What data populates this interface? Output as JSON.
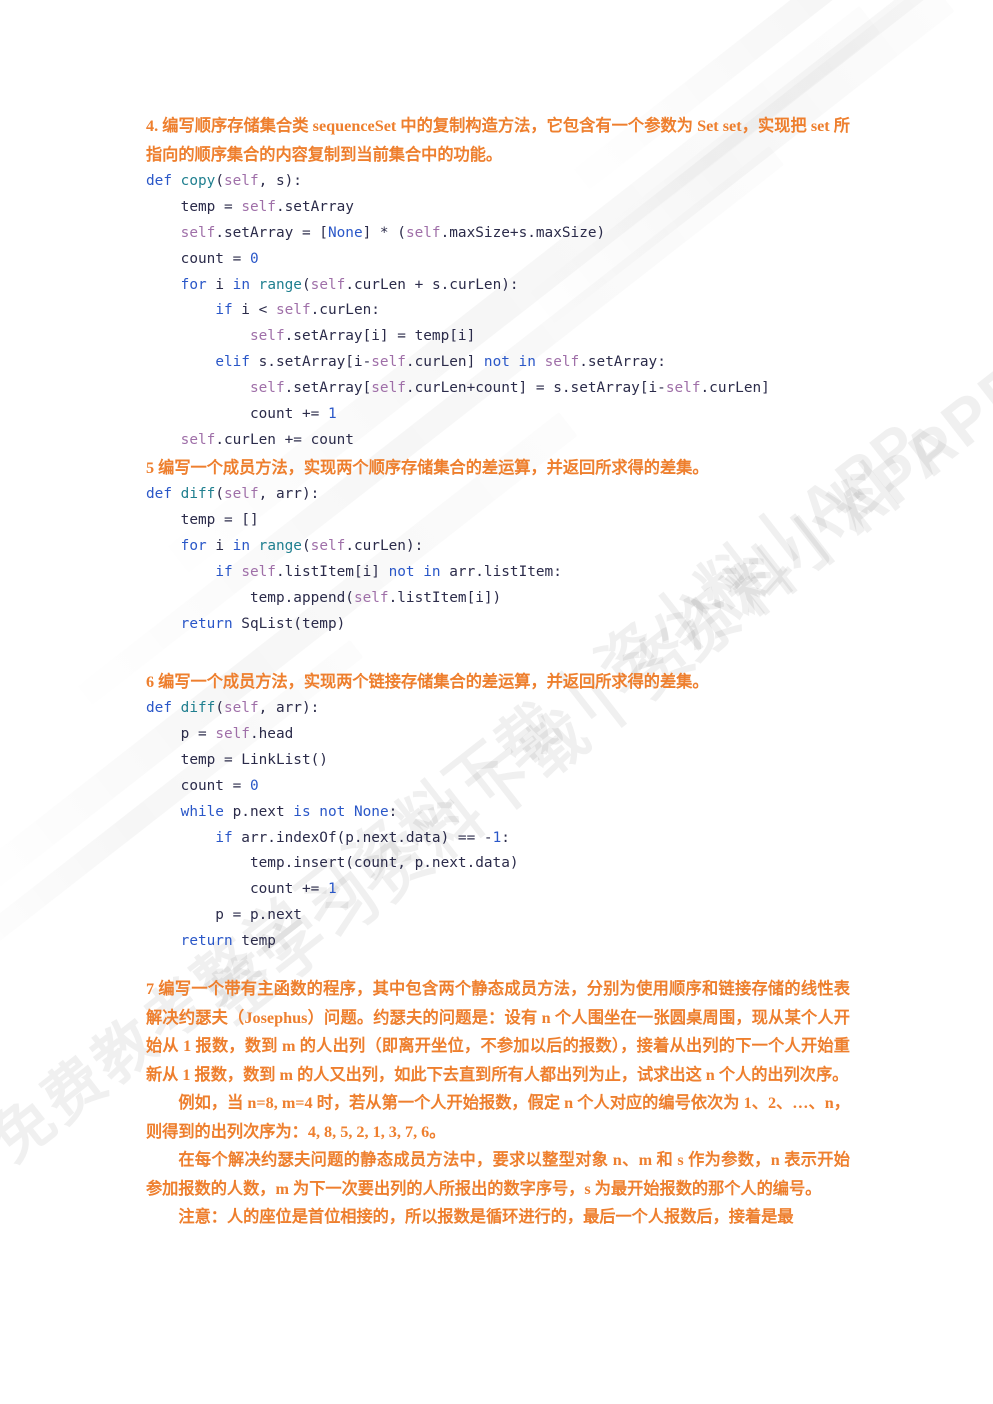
{
  "watermark": {
    "texts": [
      "资料小料 APP",
      "整学习资料下载丨资小料丨APP",
      "免费教考整学习资料下载丨资小料丨APP"
    ],
    "opacity_hint": "very-light-gray"
  },
  "sections": [
    {
      "id": "q4",
      "heading": "4. 编写顺序存储集合类 sequenceSet 中的复制构造方法，它包含有一个参数为 Set set，实现把 set 所指向的顺序集合的内容复制到当前集合中的功能。",
      "code_lines": [
        [
          {
            "t": "def ",
            "c": "kw"
          },
          {
            "t": "copy",
            "c": "fn"
          },
          {
            "t": "(",
            "c": "pl"
          },
          {
            "t": "self",
            "c": "selfk"
          },
          {
            "t": ", s):",
            "c": "pl"
          }
        ],
        [
          {
            "t": "    temp = ",
            "c": "pl"
          },
          {
            "t": "self",
            "c": "selfk"
          },
          {
            "t": ".setArray",
            "c": "pl"
          }
        ],
        [
          {
            "t": "    ",
            "c": "pl"
          },
          {
            "t": "self",
            "c": "selfk"
          },
          {
            "t": ".setArray = [",
            "c": "pl"
          },
          {
            "t": "None",
            "c": "num"
          },
          {
            "t": "] * (",
            "c": "pl"
          },
          {
            "t": "self",
            "c": "selfk"
          },
          {
            "t": ".maxSize+s.maxSize)",
            "c": "pl"
          }
        ],
        [
          {
            "t": "    count = ",
            "c": "pl"
          },
          {
            "t": "0",
            "c": "num"
          }
        ],
        [
          {
            "t": "    ",
            "c": "pl"
          },
          {
            "t": "for",
            "c": "kw"
          },
          {
            "t": " i ",
            "c": "pl"
          },
          {
            "t": "in",
            "c": "kw"
          },
          {
            "t": " ",
            "c": "pl"
          },
          {
            "t": "range",
            "c": "fn"
          },
          {
            "t": "(",
            "c": "pl"
          },
          {
            "t": "self",
            "c": "selfk"
          },
          {
            "t": ".curLen + s.curLen):",
            "c": "pl"
          }
        ],
        [
          {
            "t": "        ",
            "c": "pl"
          },
          {
            "t": "if",
            "c": "kw"
          },
          {
            "t": " i < ",
            "c": "pl"
          },
          {
            "t": "self",
            "c": "selfk"
          },
          {
            "t": ".curLen:",
            "c": "pl"
          }
        ],
        [
          {
            "t": "            ",
            "c": "pl"
          },
          {
            "t": "self",
            "c": "selfk"
          },
          {
            "t": ".setArray[i] = temp[i]",
            "c": "pl"
          }
        ],
        [
          {
            "t": "        ",
            "c": "pl"
          },
          {
            "t": "elif",
            "c": "kw"
          },
          {
            "t": " s.setArray[i-",
            "c": "pl"
          },
          {
            "t": "self",
            "c": "selfk"
          },
          {
            "t": ".curLen] ",
            "c": "pl"
          },
          {
            "t": "not in",
            "c": "kw"
          },
          {
            "t": " ",
            "c": "pl"
          },
          {
            "t": "self",
            "c": "selfk"
          },
          {
            "t": ".setArray:",
            "c": "pl"
          }
        ],
        [
          {
            "t": "            ",
            "c": "pl"
          },
          {
            "t": "self",
            "c": "selfk"
          },
          {
            "t": ".setArray[",
            "c": "pl"
          },
          {
            "t": "self",
            "c": "selfk"
          },
          {
            "t": ".curLen+count] = s.setArray[i-",
            "c": "pl"
          },
          {
            "t": "self",
            "c": "selfk"
          },
          {
            "t": ".curLen]",
            "c": "pl"
          }
        ],
        [
          {
            "t": "            count += ",
            "c": "pl"
          },
          {
            "t": "1",
            "c": "num"
          }
        ],
        [
          {
            "t": "    ",
            "c": "pl"
          },
          {
            "t": "self",
            "c": "selfk"
          },
          {
            "t": ".curLen += count",
            "c": "pl"
          }
        ]
      ]
    },
    {
      "id": "q5",
      "heading": "5 编写一个成员方法，实现两个顺序存储集合的差运算，并返回所求得的差集。",
      "code_lines": [
        [
          {
            "t": "def ",
            "c": "kw"
          },
          {
            "t": "diff",
            "c": "fn"
          },
          {
            "t": "(",
            "c": "pl"
          },
          {
            "t": "self",
            "c": "selfk"
          },
          {
            "t": ", arr):",
            "c": "pl"
          }
        ],
        [
          {
            "t": "    temp = []",
            "c": "pl"
          }
        ],
        [
          {
            "t": "    ",
            "c": "pl"
          },
          {
            "t": "for",
            "c": "kw"
          },
          {
            "t": " i ",
            "c": "pl"
          },
          {
            "t": "in",
            "c": "kw"
          },
          {
            "t": " ",
            "c": "pl"
          },
          {
            "t": "range",
            "c": "fn"
          },
          {
            "t": "(",
            "c": "pl"
          },
          {
            "t": "self",
            "c": "selfk"
          },
          {
            "t": ".curLen):",
            "c": "pl"
          }
        ],
        [
          {
            "t": "        ",
            "c": "pl"
          },
          {
            "t": "if",
            "c": "kw"
          },
          {
            "t": " ",
            "c": "pl"
          },
          {
            "t": "self",
            "c": "selfk"
          },
          {
            "t": ".listItem[i] ",
            "c": "pl"
          },
          {
            "t": "not in",
            "c": "kw"
          },
          {
            "t": " arr.listItem:",
            "c": "pl"
          }
        ],
        [
          {
            "t": "            temp.append(",
            "c": "pl"
          },
          {
            "t": "self",
            "c": "selfk"
          },
          {
            "t": ".listItem[i])",
            "c": "pl"
          }
        ],
        [
          {
            "t": "    ",
            "c": "pl"
          },
          {
            "t": "return",
            "c": "kw"
          },
          {
            "t": " SqList(temp)",
            "c": "pl"
          }
        ]
      ]
    },
    {
      "id": "q6",
      "heading": "6 编写一个成员方法，实现两个链接存储集合的差运算，并返回所求得的差集。",
      "code_lines": [
        [
          {
            "t": "def ",
            "c": "kw"
          },
          {
            "t": "diff",
            "c": "fn"
          },
          {
            "t": "(",
            "c": "pl"
          },
          {
            "t": "self",
            "c": "selfk"
          },
          {
            "t": ", arr):",
            "c": "pl"
          }
        ],
        [
          {
            "t": "    p = ",
            "c": "pl"
          },
          {
            "t": "self",
            "c": "selfk"
          },
          {
            "t": ".head",
            "c": "pl"
          }
        ],
        [
          {
            "t": "    temp = LinkList()",
            "c": "pl"
          }
        ],
        [
          {
            "t": "    count = ",
            "c": "pl"
          },
          {
            "t": "0",
            "c": "num"
          }
        ],
        [
          {
            "t": "    ",
            "c": "pl"
          },
          {
            "t": "while",
            "c": "kw"
          },
          {
            "t": " p.next ",
            "c": "pl"
          },
          {
            "t": "is not",
            "c": "kw"
          },
          {
            "t": " ",
            "c": "pl"
          },
          {
            "t": "None",
            "c": "num"
          },
          {
            "t": ":",
            "c": "pl"
          }
        ],
        [
          {
            "t": "        ",
            "c": "pl"
          },
          {
            "t": "if",
            "c": "kw"
          },
          {
            "t": " arr.indexOf(p.next.data) == -",
            "c": "pl"
          },
          {
            "t": "1",
            "c": "num"
          },
          {
            "t": ":",
            "c": "pl"
          }
        ],
        [
          {
            "t": "            temp.insert(count, p.next.data)",
            "c": "pl"
          }
        ],
        [
          {
            "t": "            count += ",
            "c": "pl"
          },
          {
            "t": "1",
            "c": "num"
          }
        ],
        [
          {
            "t": "        p = p.next",
            "c": "pl"
          }
        ],
        [
          {
            "t": "    ",
            "c": "pl"
          },
          {
            "t": "return",
            "c": "kw"
          },
          {
            "t": " temp",
            "c": "pl"
          }
        ]
      ]
    }
  ],
  "question7": {
    "paragraphs": [
      {
        "indent": false,
        "text": "7 编写一个带有主函数的程序，其中包含两个静态成员方法，分别为使用顺序和链接存储的线性表解决约瑟夫（Josephus）问题。约瑟夫的问题是：设有 n 个人围坐在一张圆桌周围，现从某个人开始从 1 报数，数到 m 的人出列（即离开坐位，不参加以后的报数），接着从出列的下一个人开始重新从 1 报数，数到 m 的人又出列，如此下去直到所有人都出列为止，试求出这 n 个人的出列次序。"
      },
      {
        "indent": true,
        "text": "例如，当 n=8, m=4 时，若从第一个人开始报数，假定 n 个人对应的编号依次为 1、2、…、n，则得到的出列次序为：4, 8, 5, 2, 1, 3, 7, 6。"
      },
      {
        "indent": true,
        "text": "在每个解决约瑟夫问题的静态成员方法中，要求以整型对象 n、m 和 s 作为参数，n 表示开始参加报数的人数，m 为下一次要出列的人所报出的数字序号，s 为最开始报数的那个人的编号。"
      },
      {
        "indent": true,
        "text": "注意：人的座位是首位相接的，所以报数是循环进行的，最后一个人报数后，接着是最"
      }
    ]
  },
  "colors": {
    "prose_orange": "#ee7f2e",
    "code_plain": "#2b2b4a",
    "code_keyword": "#2a57c8",
    "code_function": "#1f7f8f",
    "code_self": "#9f6fa8",
    "page_background": "#ffffff"
  }
}
